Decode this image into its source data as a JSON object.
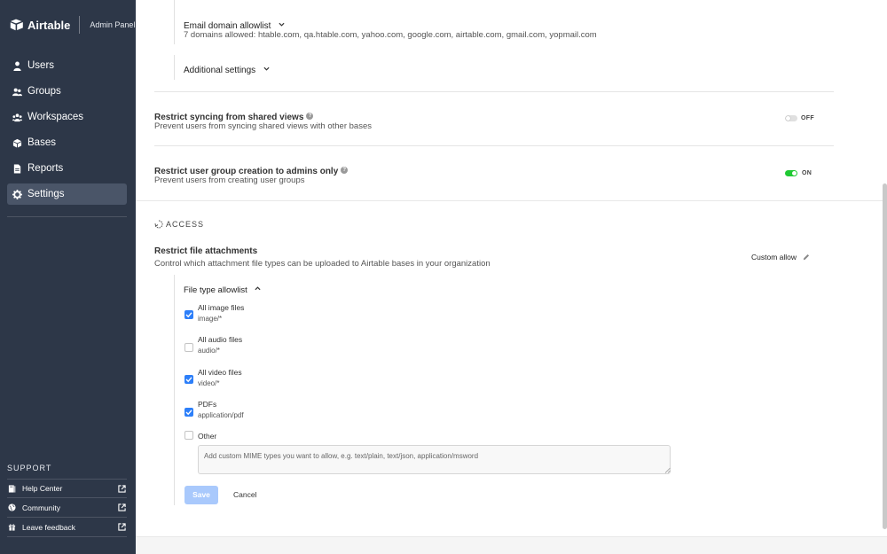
{
  "brand": {
    "name": "Airtable",
    "panel": "Admin Panel"
  },
  "nav": [
    {
      "label": "Users",
      "icon": "user-icon",
      "active": false
    },
    {
      "label": "Groups",
      "icon": "groups-icon",
      "active": false
    },
    {
      "label": "Workspaces",
      "icon": "workspaces-icon",
      "active": false
    },
    {
      "label": "Bases",
      "icon": "bases-icon",
      "active": false
    },
    {
      "label": "Reports",
      "icon": "reports-icon",
      "active": false
    },
    {
      "label": "Settings",
      "icon": "gear-icon",
      "active": true
    }
  ],
  "support": {
    "heading": "SUPPORT",
    "items": [
      {
        "label": "Help Center",
        "icon": "book-icon"
      },
      {
        "label": "Community",
        "icon": "globe-icon"
      },
      {
        "label": "Leave feedback",
        "icon": "gift-icon"
      }
    ]
  },
  "email_allowlist": {
    "title": "Email domain allowlist",
    "summary": "7 domains allowed: htable.com, qa.htable.com, yahoo.com, google.com, airtable.com, gmail.com, yopmail.com"
  },
  "additional_settings": {
    "label": "Additional settings"
  },
  "restrict_syncing": {
    "title": "Restrict syncing from shared views",
    "description": "Prevent users from syncing shared views with other bases",
    "state": "OFF"
  },
  "restrict_groups": {
    "title": "Restrict user group creation to admins only",
    "description": "Prevent users from creating user groups",
    "state": "ON"
  },
  "access": {
    "heading": "ACCESS",
    "restrict_attachments": {
      "title": "Restrict file attachments",
      "description": "Control which attachment file types can be uploaded to Airtable bases in your organization",
      "mode": "Custom allow"
    },
    "file_type_allowlist": {
      "label": "File type allowlist",
      "options": [
        {
          "title": "All image files",
          "sub": "image/*",
          "checked": true
        },
        {
          "title": "All audio files",
          "sub": "audio/*",
          "checked": false
        },
        {
          "title": "All video files",
          "sub": "video/*",
          "checked": true
        },
        {
          "title": "PDFs",
          "sub": "application/pdf",
          "checked": true
        },
        {
          "title": "Other",
          "sub": "",
          "checked": false
        }
      ],
      "mime_placeholder": "Add custom MIME types you want to allow, e.g. text/plain, text/json, application/msword",
      "mime_value": ""
    },
    "save_label": "Save",
    "cancel_label": "Cancel"
  },
  "colors": {
    "sidebar_bg": "#2d3748",
    "sidebar_active": "#4a5568",
    "toggle_on": "#20c933",
    "checkbox_blue": "#2d7ff9",
    "save_disabled": "#a9c9fc"
  }
}
